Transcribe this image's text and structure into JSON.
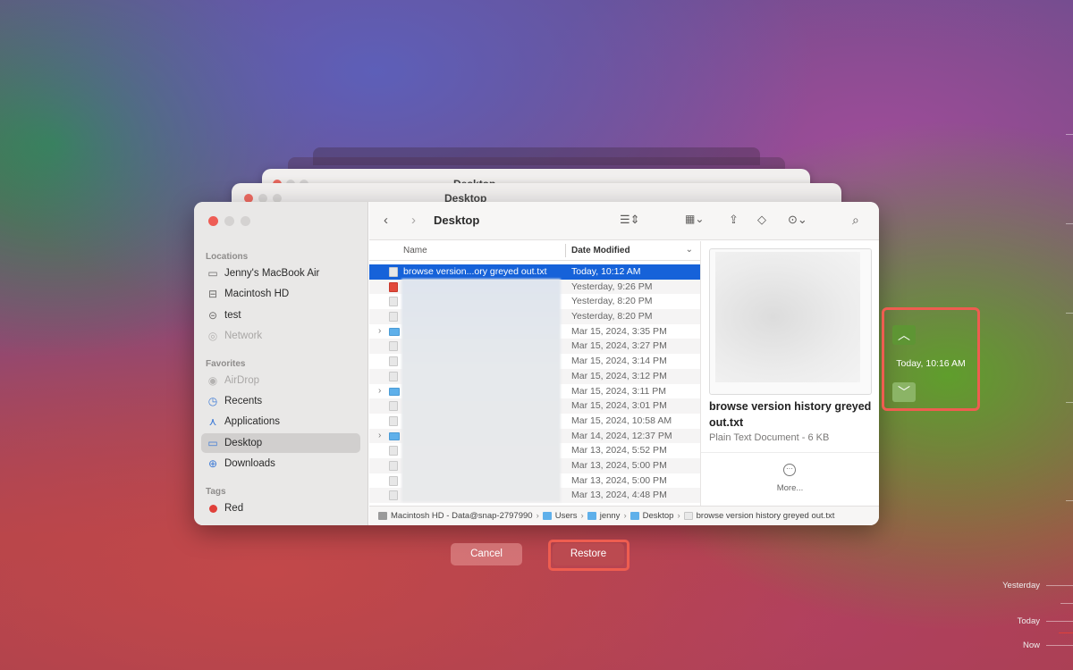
{
  "window": {
    "title": "Desktop",
    "background_titles": [
      "Desktop",
      "Desktop"
    ]
  },
  "sidebar": {
    "sections": [
      {
        "title": "Locations",
        "items": [
          {
            "label": "Jenny's MacBook Air",
            "icon": "laptop-icon"
          },
          {
            "label": "Macintosh HD",
            "icon": "harddrive-icon"
          },
          {
            "label": "test",
            "icon": "external-drive-icon"
          },
          {
            "label": "Network",
            "icon": "network-icon"
          }
        ]
      },
      {
        "title": "Favorites",
        "items": [
          {
            "label": "AirDrop",
            "icon": "airdrop-icon"
          },
          {
            "label": "Recents",
            "icon": "clock-icon"
          },
          {
            "label": "Applications",
            "icon": "applications-icon"
          },
          {
            "label": "Desktop",
            "icon": "desktop-icon",
            "selected": true
          },
          {
            "label": "Downloads",
            "icon": "download-icon"
          }
        ]
      },
      {
        "title": "Tags",
        "items": [
          {
            "label": "Red",
            "icon": "tag-dot-icon",
            "color": "#e0403a"
          }
        ]
      }
    ]
  },
  "columns": {
    "name": "Name",
    "date_modified": "Date Modified"
  },
  "files": [
    {
      "name": "browse version...ory greyed out.txt",
      "date": "Today, 10:12 AM",
      "selected": true
    },
    {
      "name": "",
      "date": "Yesterday, 9:26 PM"
    },
    {
      "name": "",
      "date": "Yesterday, 8:20 PM"
    },
    {
      "name": "",
      "date": "Yesterday, 8:20 PM"
    },
    {
      "name": "",
      "date": "Mar 15, 2024, 3:35 PM"
    },
    {
      "name": "",
      "date": "Mar 15, 2024, 3:27 PM"
    },
    {
      "name": "",
      "date": "Mar 15, 2024, 3:14 PM"
    },
    {
      "name": "",
      "date": "Mar 15, 2024, 3:12 PM"
    },
    {
      "name": "",
      "date": "Mar 15, 2024, 3:11 PM"
    },
    {
      "name": "",
      "date": "Mar 15, 2024, 3:01 PM"
    },
    {
      "name": "",
      "date": "Mar 15, 2024, 10:58 AM"
    },
    {
      "name": "",
      "date": "Mar 14, 2024, 12:37 PM"
    },
    {
      "name": "",
      "date": "Mar 13, 2024, 5:52 PM"
    },
    {
      "name": "",
      "date": "Mar 13, 2024, 5:00 PM"
    },
    {
      "name": "",
      "date": "Mar 13, 2024, 5:00 PM"
    },
    {
      "name": "",
      "date": "Mar 13, 2024, 4:48 PM"
    }
  ],
  "preview": {
    "name": "browse version history greyed out.txt",
    "kind": "Plain Text Document - 6 KB",
    "more": "More..."
  },
  "pathbar": [
    "Macintosh HD - Data@snap-2797990",
    "Users",
    "jenny",
    "Desktop",
    "browse version history greyed out.txt"
  ],
  "version_nav": {
    "time": "Today, 10:16 AM"
  },
  "buttons": {
    "cancel": "Cancel",
    "restore": "Restore"
  },
  "timeline": {
    "labels": [
      "Yesterday",
      "Today",
      "Now"
    ]
  }
}
